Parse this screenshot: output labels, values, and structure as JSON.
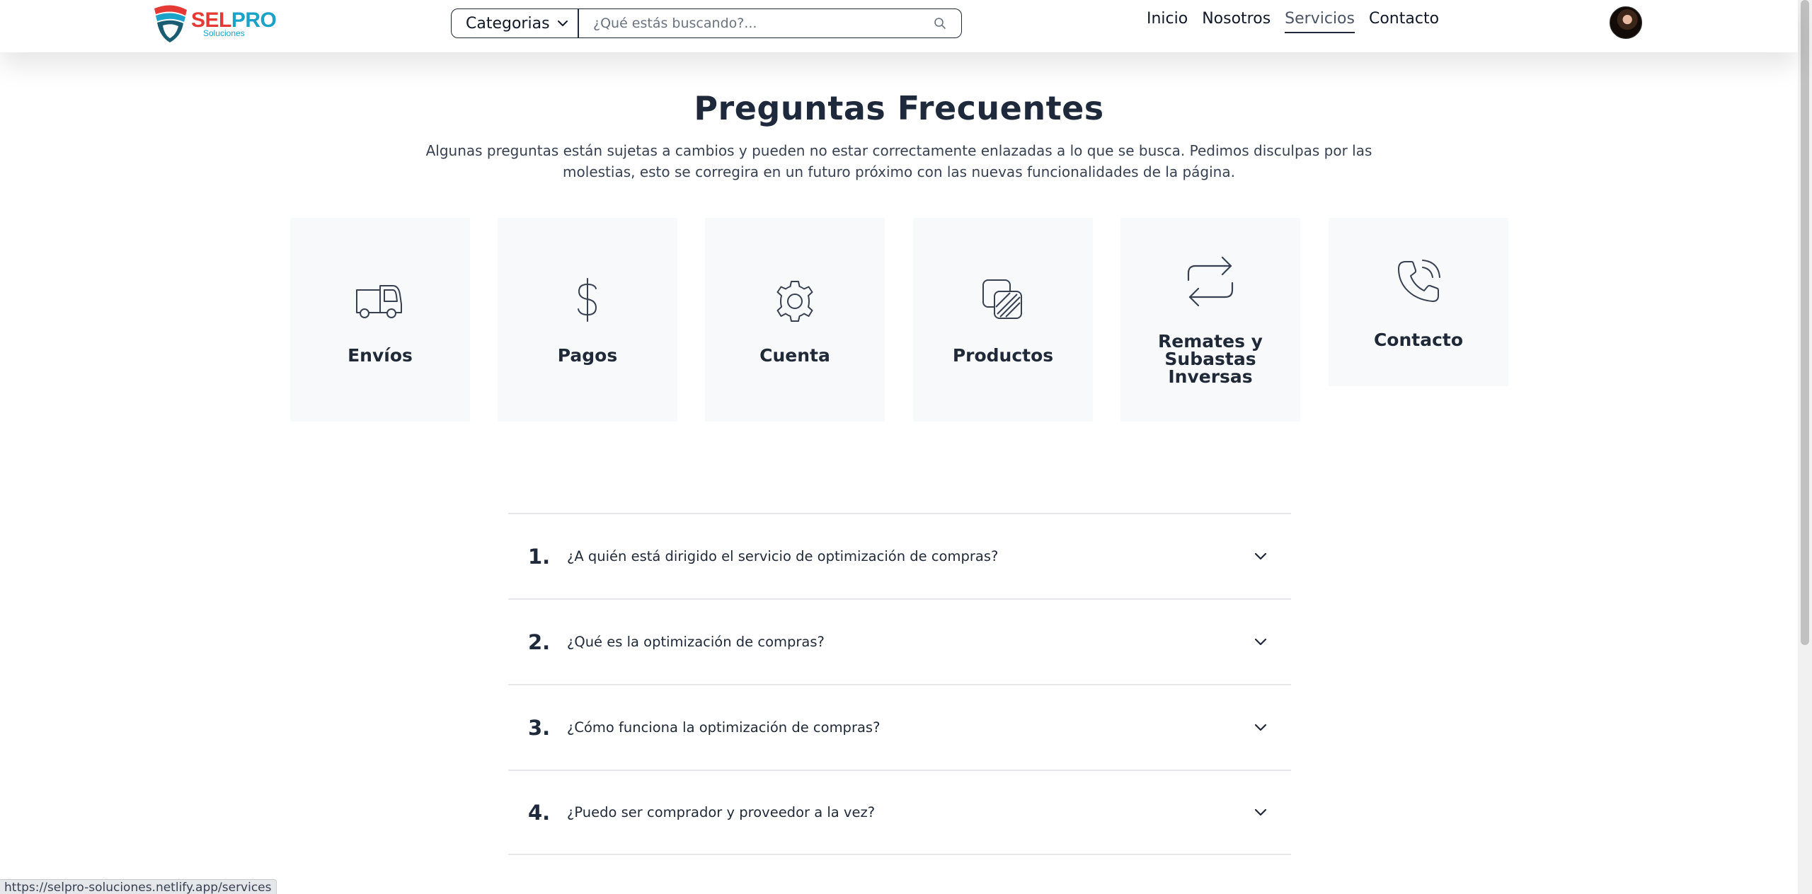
{
  "header": {
    "logo": {
      "brand_a": "SEL",
      "brand_b": "PRO",
      "tagline": "Soluciones"
    },
    "search": {
      "category_label": "Categorias",
      "placeholder": "¿Qué estás buscando?...",
      "value": ""
    },
    "nav": [
      {
        "label": "Inicio",
        "active": false
      },
      {
        "label": "Nosotros",
        "active": false
      },
      {
        "label": "Servicios",
        "active": true
      },
      {
        "label": "Contacto",
        "active": false
      }
    ]
  },
  "main": {
    "title": "Preguntas Frecuentes",
    "subtitle": "Algunas preguntas están sujetas a cambios y pueden no estar correctamente enlazadas a lo que se busca. Pedimos disculpas por las molestias, esto se corregira en un futuro próximo con las nuevas funcionalidades de la página.",
    "categories": [
      {
        "label": "Envíos",
        "icon": "truck-icon"
      },
      {
        "label": "Pagos",
        "icon": "dollar-icon"
      },
      {
        "label": "Cuenta",
        "icon": "gear-icon"
      },
      {
        "label": "Productos",
        "icon": "layers-icon"
      },
      {
        "label": "Remates y Subastas Inversas",
        "icon": "arrows-swap-icon"
      },
      {
        "label": "Contacto",
        "icon": "phone-call-icon"
      }
    ],
    "faq": [
      {
        "num": "1.",
        "question": "¿A quién está dirigido el servicio de optimización de compras?"
      },
      {
        "num": "2.",
        "question": "¿Qué es la optimización de compras?"
      },
      {
        "num": "3.",
        "question": "¿Cómo funciona la optimización de compras?"
      },
      {
        "num": "4.",
        "question": "¿Puedo ser comprador y proveedor a la vez?"
      }
    ]
  },
  "status_bar": {
    "url": "https://selpro-soluciones.netlify.app/services"
  },
  "colors": {
    "brand_red": "#e53935",
    "brand_blue": "#1aa3c9",
    "title": "#1e293b",
    "card_bg": "#f8f9fb"
  }
}
